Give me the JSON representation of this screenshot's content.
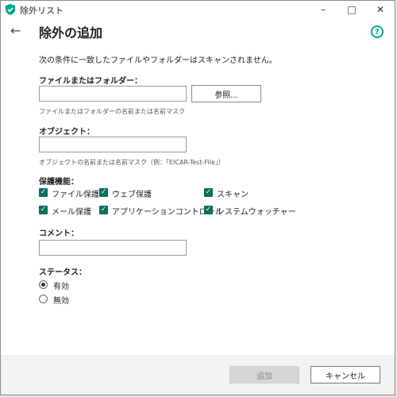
{
  "window": {
    "title": "除外リスト"
  },
  "colors": {
    "accent": "#0b6e5e",
    "help": "#00a88e"
  },
  "icons": {
    "app": "shield-icon",
    "minimize": "minimize-icon",
    "maximize": "maximize-icon",
    "close": "close-icon",
    "back": "back-arrow-icon",
    "help": "help-icon"
  },
  "page": {
    "title": "除外の追加",
    "description": "次の条件に一致したファイルやフォルダーはスキャンされません。"
  },
  "file_folder": {
    "label": "ファイルまたはフォルダー：",
    "value": "",
    "browse_label": "参照...",
    "hint": "ファイルまたはフォルダーの名前または名前マスク"
  },
  "object": {
    "label": "オブジェクト：",
    "value": "",
    "hint": "オブジェクトの名前または名前マスク（例：「EICAR-Test-File」）"
  },
  "protection": {
    "label": "保護機能：",
    "items": [
      {
        "label": "ファイル保護",
        "checked": true
      },
      {
        "label": "ウェブ保護",
        "checked": true
      },
      {
        "label": "スキャン",
        "checked": true
      },
      {
        "label": "メール保護",
        "checked": true
      },
      {
        "label": "アプリケーションコントロール",
        "checked": true
      },
      {
        "label": "システムウォッチャー",
        "checked": true
      }
    ]
  },
  "comment": {
    "label": "コメント：",
    "value": ""
  },
  "status": {
    "label": "ステータス：",
    "options": [
      {
        "label": "有効",
        "selected": true
      },
      {
        "label": "無効",
        "selected": false
      }
    ]
  },
  "footer": {
    "add_label": "追加",
    "cancel_label": "キャンセル"
  }
}
